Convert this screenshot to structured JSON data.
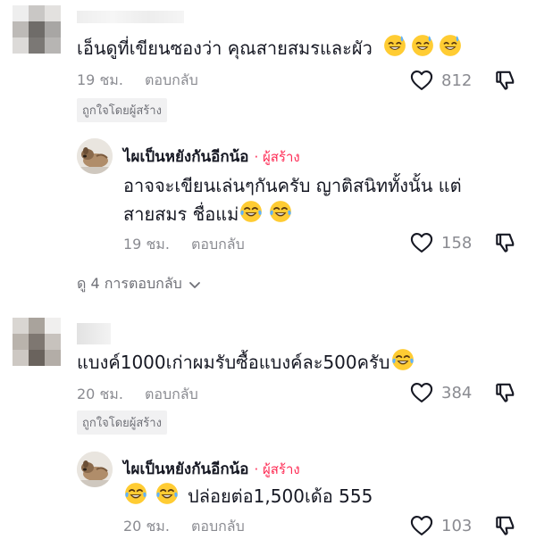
{
  "thread1": {
    "comment": {
      "text": "เอ็นดูที่เขียนซองว่า คุณสายสมรและผัว",
      "time": "19 ชม.",
      "reply_label": "ตอบกลับ",
      "likes": "812",
      "creator_liked_badge": "ถูกใจโดยผู้สร้าง",
      "emoji": [
        "sweat-smile-emoji",
        "sweat-smile-emoji",
        "sweat-smile-emoji"
      ]
    },
    "reply": {
      "author": "ไผเป็นหยังกันอีกน้อ",
      "creator_label": "· ผู้สร้าง",
      "line1": "อาจจะเขียนเล่นๆกันครับ ญาติสนิททั้งนั้น แต่",
      "line2": "สายสมร ชื่อแม่",
      "time": "19 ชม.",
      "reply_label": "ตอบกลับ",
      "likes": "158",
      "emoji": [
        "joy-emoji",
        "joy-emoji"
      ]
    },
    "view_replies": "ดู 4 การตอบกลับ"
  },
  "thread2": {
    "comment": {
      "text": "แบงค์1000เก่าผมรับซื้อแบงค์ละ500ครับ",
      "time": "20 ชม.",
      "reply_label": "ตอบกลับ",
      "likes": "384",
      "creator_liked_badge": "ถูกใจโดยผู้สร้าง",
      "emoji": [
        "joy-emoji"
      ]
    },
    "reply": {
      "author": "ไผเป็นหยังกันอีกน้อ",
      "creator_label": "· ผู้สร้าง",
      "text": "ปล่อยต่อ1,500เด้อ 555",
      "time": "20 ชม.",
      "reply_label": "ตอบกลับ",
      "likes": "103",
      "emoji": [
        "joy-emoji",
        "joy-emoji"
      ]
    }
  },
  "colors": {
    "accent_creator": "#fe2c55",
    "meta_gray": "#8a8b91",
    "badge_bg": "#f1f1f2"
  }
}
